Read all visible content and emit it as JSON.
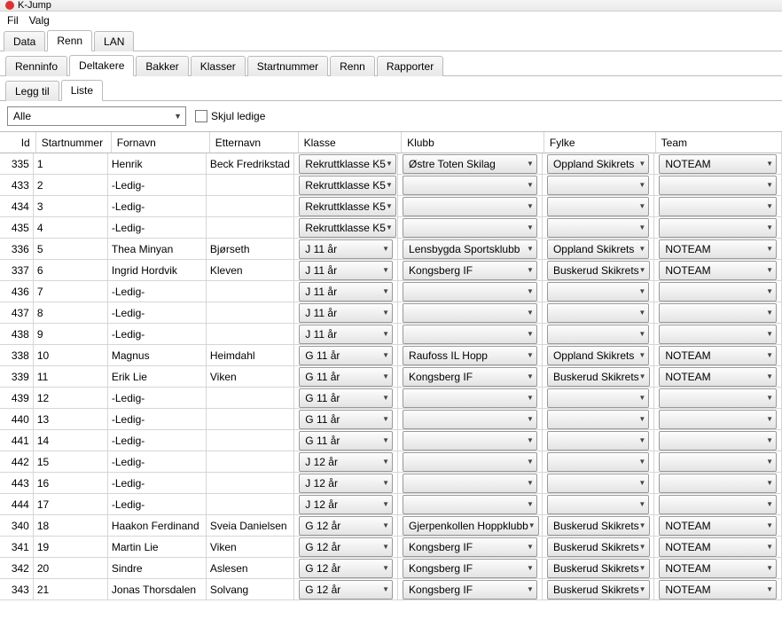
{
  "title": "K-Jump",
  "menu": [
    "Fil",
    "Valg"
  ],
  "tabsL1": {
    "items": [
      "Data",
      "Renn",
      "LAN"
    ],
    "active": 1
  },
  "tabsL2": {
    "items": [
      "Renninfo",
      "Deltakere",
      "Bakker",
      "Klasser",
      "Startnummer",
      "Renn",
      "Rapporter"
    ],
    "active": 1
  },
  "tabsL3": {
    "items": [
      "Legg til",
      "Liste"
    ],
    "active": 1
  },
  "filter": {
    "value": "Alle",
    "skjul_label": "Skjul ledige",
    "skjul_checked": false
  },
  "columns": [
    "Id",
    "Startnummer",
    "Fornavn",
    "Etternavn",
    "Klasse",
    "Klubb",
    "Fylke",
    "Team"
  ],
  "rows": [
    {
      "id": "335",
      "start": "1",
      "fornavn": "Henrik",
      "etternavn": "Beck Fredrikstad",
      "klasse": "Rekruttklasse K5",
      "klubb": "Østre Toten Skilag",
      "fylke": "Oppland Skikrets",
      "team": "NOTEAM"
    },
    {
      "id": "433",
      "start": "2",
      "fornavn": "-Ledig-",
      "etternavn": "",
      "klasse": "Rekruttklasse K5",
      "klubb": "",
      "fylke": "",
      "team": ""
    },
    {
      "id": "434",
      "start": "3",
      "fornavn": "-Ledig-",
      "etternavn": "",
      "klasse": "Rekruttklasse K5",
      "klubb": "",
      "fylke": "",
      "team": ""
    },
    {
      "id": "435",
      "start": "4",
      "fornavn": "-Ledig-",
      "etternavn": "",
      "klasse": "Rekruttklasse K5",
      "klubb": "",
      "fylke": "",
      "team": ""
    },
    {
      "id": "336",
      "start": "5",
      "fornavn": "Thea Minyan",
      "etternavn": "Bjørseth",
      "klasse": "J 11 år",
      "klubb": "Lensbygda Sportsklubb",
      "fylke": "Oppland Skikrets",
      "team": "NOTEAM"
    },
    {
      "id": "337",
      "start": "6",
      "fornavn": "Ingrid Hordvik",
      "etternavn": "Kleven",
      "klasse": "J 11 år",
      "klubb": "Kongsberg IF",
      "fylke": "Buskerud Skikrets",
      "team": "NOTEAM"
    },
    {
      "id": "436",
      "start": "7",
      "fornavn": "-Ledig-",
      "etternavn": "",
      "klasse": "J 11 år",
      "klubb": "",
      "fylke": "",
      "team": ""
    },
    {
      "id": "437",
      "start": "8",
      "fornavn": "-Ledig-",
      "etternavn": "",
      "klasse": "J 11 år",
      "klubb": "",
      "fylke": "",
      "team": ""
    },
    {
      "id": "438",
      "start": "9",
      "fornavn": "-Ledig-",
      "etternavn": "",
      "klasse": "J 11 år",
      "klubb": "",
      "fylke": "",
      "team": ""
    },
    {
      "id": "338",
      "start": "10",
      "fornavn": "Magnus",
      "etternavn": "Heimdahl",
      "klasse": "G 11 år",
      "klubb": "Raufoss IL  Hopp",
      "fylke": "Oppland Skikrets",
      "team": "NOTEAM"
    },
    {
      "id": "339",
      "start": "11",
      "fornavn": "Erik Lie",
      "etternavn": "Viken",
      "klasse": "G 11 år",
      "klubb": "Kongsberg IF",
      "fylke": "Buskerud Skikrets",
      "team": "NOTEAM"
    },
    {
      "id": "439",
      "start": "12",
      "fornavn": "-Ledig-",
      "etternavn": "",
      "klasse": "G 11 år",
      "klubb": "",
      "fylke": "",
      "team": ""
    },
    {
      "id": "440",
      "start": "13",
      "fornavn": "-Ledig-",
      "etternavn": "",
      "klasse": "G 11 år",
      "klubb": "",
      "fylke": "",
      "team": ""
    },
    {
      "id": "441",
      "start": "14",
      "fornavn": "-Ledig-",
      "etternavn": "",
      "klasse": "G 11 år",
      "klubb": "",
      "fylke": "",
      "team": ""
    },
    {
      "id": "442",
      "start": "15",
      "fornavn": "-Ledig-",
      "etternavn": "",
      "klasse": "J 12 år",
      "klubb": "",
      "fylke": "",
      "team": ""
    },
    {
      "id": "443",
      "start": "16",
      "fornavn": "-Ledig-",
      "etternavn": "",
      "klasse": "J 12 år",
      "klubb": "",
      "fylke": "",
      "team": ""
    },
    {
      "id": "444",
      "start": "17",
      "fornavn": "-Ledig-",
      "etternavn": "",
      "klasse": "J 12 år",
      "klubb": "",
      "fylke": "",
      "team": ""
    },
    {
      "id": "340",
      "start": "18",
      "fornavn": "Haakon Ferdinand",
      "etternavn": "Sveia Danielsen",
      "klasse": "G 12 år",
      "klubb": "Gjerpenkollen Hoppklubb",
      "fylke": "Buskerud Skikrets",
      "team": "NOTEAM"
    },
    {
      "id": "341",
      "start": "19",
      "fornavn": "Martin Lie",
      "etternavn": "Viken",
      "klasse": "G 12 år",
      "klubb": "Kongsberg IF",
      "fylke": "Buskerud Skikrets",
      "team": "NOTEAM"
    },
    {
      "id": "342",
      "start": "20",
      "fornavn": "Sindre",
      "etternavn": "Aslesen",
      "klasse": "G 12 år",
      "klubb": "Kongsberg IF",
      "fylke": "Buskerud Skikrets",
      "team": "NOTEAM"
    },
    {
      "id": "343",
      "start": "21",
      "fornavn": "Jonas Thorsdalen",
      "etternavn": "Solvang",
      "klasse": "G 12 år",
      "klubb": "Kongsberg IF",
      "fylke": "Buskerud Skikrets",
      "team": "NOTEAM"
    }
  ]
}
